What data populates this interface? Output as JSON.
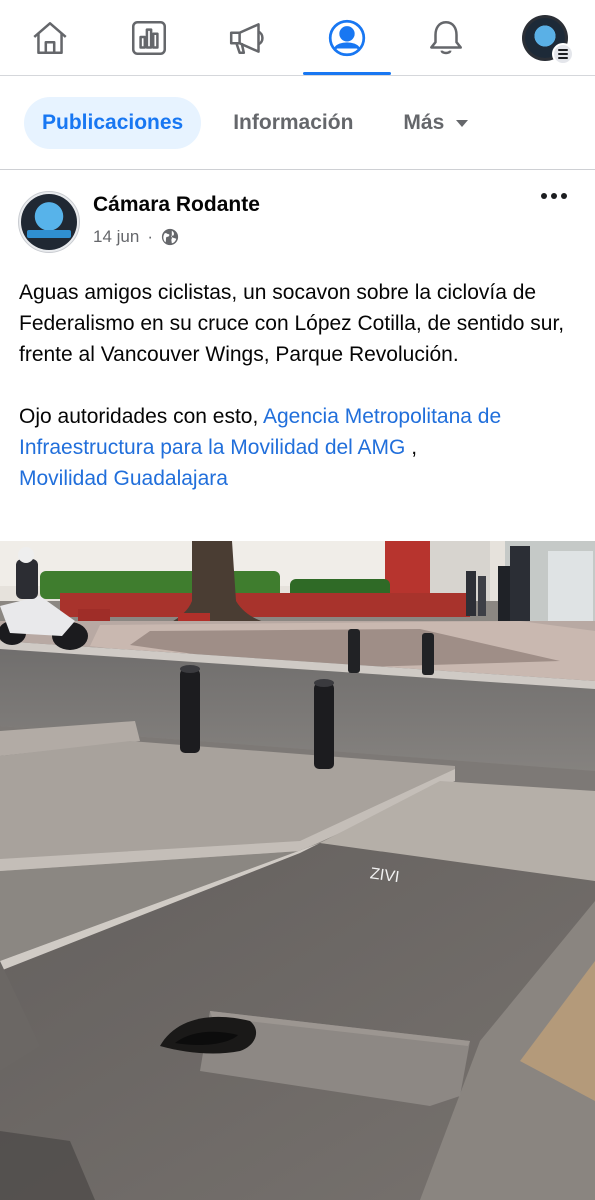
{
  "nav": {
    "items": [
      {
        "name": "home",
        "icon": "home-icon",
        "active": false
      },
      {
        "name": "dashboard",
        "icon": "bar-chart-icon",
        "active": false
      },
      {
        "name": "ads",
        "icon": "megaphone-icon",
        "active": false
      },
      {
        "name": "profile",
        "icon": "profile-icon",
        "active": true
      },
      {
        "name": "notifications",
        "icon": "bell-icon",
        "active": false
      },
      {
        "name": "menu",
        "icon": "avatar-menu-icon",
        "active": false
      }
    ],
    "accent_color": "#1877f2"
  },
  "profile_tabs": {
    "posts": "Publicaciones",
    "about": "Información",
    "more": "Más"
  },
  "post": {
    "page_name": "Cámara Rodante",
    "date": "14 jun",
    "privacy_icon": "globe-icon",
    "more_icon": "more-horizontal-icon",
    "text_paragraph_1": "Aguas amigos ciclistas, un socavon sobre la ciclovía de  Federalismo en su cruce con López Cotilla, de sentido sur, frente al Vancouver Wings, Parque Revolución.",
    "text_paragraph_2_prefix": "Ojo autoridades con esto, ",
    "mention_1": "Agencia Metropolitana de Infraestructura para la Movilidad del AMG",
    "separator": " ,",
    "mention_2": "Movilidad Guadalajara",
    "link_color": "#216fdb",
    "road_marking": "ZIVI"
  }
}
